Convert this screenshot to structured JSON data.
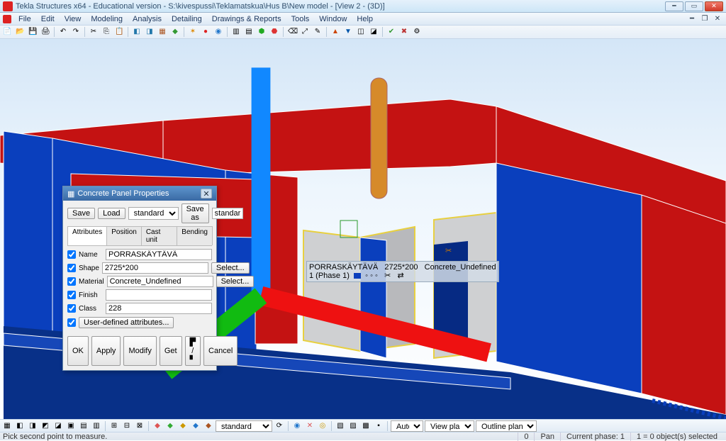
{
  "window": {
    "title": "Tekla Structures x64 - Educational version - S:\\kivespussi\\Teklamatskua\\Hus B\\New model  - [View 2 - (3D)]"
  },
  "menu": {
    "items": [
      "File",
      "Edit",
      "View",
      "Modeling",
      "Analysis",
      "Detailing",
      "Drawings & Reports",
      "Tools",
      "Window",
      "Help"
    ]
  },
  "dialog": {
    "title": "Concrete Panel Properties",
    "save": "Save",
    "load": "Load",
    "preset": "standard",
    "saveas": "Save as",
    "saveas_value": "standard",
    "tabs": [
      "Attributes",
      "Position",
      "Cast unit",
      "Bending"
    ],
    "fields": {
      "name_lbl": "Name",
      "name_val": "PORRASKÄYTÄVÄ",
      "shape_lbl": "Shape",
      "shape_val": "2725*200",
      "select": "Select...",
      "material_lbl": "Material",
      "material_val": "Concrete_Undefined",
      "finish_lbl": "Finish",
      "finish_val": "",
      "class_lbl": "Class",
      "class_val": "228"
    },
    "uda": "User-defined attributes...",
    "buttons": {
      "ok": "OK",
      "apply": "Apply",
      "modify": "Modify",
      "get": "Get",
      "cancel": "Cancel"
    }
  },
  "tooltip": {
    "line1a": "PORRASKÄYTÄVÄ",
    "line1b": "2725*200",
    "line1c": "Concrete_Undefined",
    "line2": "1 (Phase 1)"
  },
  "bottombar": {
    "preset": "standard",
    "auto": "Auto",
    "viewplane": "View plane",
    "outline": "Outline planes"
  },
  "status": {
    "prompt": "Pick second point to measure.",
    "pan_value": "0",
    "pan_label": "Pan",
    "phase": "Current phase: 1",
    "selected": "1 = 0 object(s) selected"
  }
}
